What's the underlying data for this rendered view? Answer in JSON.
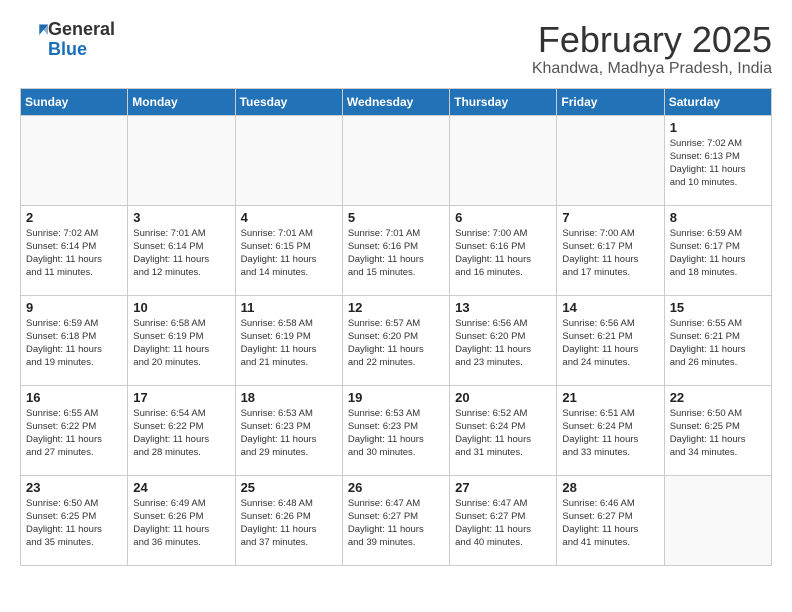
{
  "header": {
    "logo_line1": "General",
    "logo_line2": "Blue",
    "month_title": "February 2025",
    "location": "Khandwa, Madhya Pradesh, India"
  },
  "weekdays": [
    "Sunday",
    "Monday",
    "Tuesday",
    "Wednesday",
    "Thursday",
    "Friday",
    "Saturday"
  ],
  "weeks": [
    [
      {
        "day": "",
        "info": ""
      },
      {
        "day": "",
        "info": ""
      },
      {
        "day": "",
        "info": ""
      },
      {
        "day": "",
        "info": ""
      },
      {
        "day": "",
        "info": ""
      },
      {
        "day": "",
        "info": ""
      },
      {
        "day": "1",
        "info": "Sunrise: 7:02 AM\nSunset: 6:13 PM\nDaylight: 11 hours\nand 10 minutes."
      }
    ],
    [
      {
        "day": "2",
        "info": "Sunrise: 7:02 AM\nSunset: 6:14 PM\nDaylight: 11 hours\nand 11 minutes."
      },
      {
        "day": "3",
        "info": "Sunrise: 7:01 AM\nSunset: 6:14 PM\nDaylight: 11 hours\nand 12 minutes."
      },
      {
        "day": "4",
        "info": "Sunrise: 7:01 AM\nSunset: 6:15 PM\nDaylight: 11 hours\nand 14 minutes."
      },
      {
        "day": "5",
        "info": "Sunrise: 7:01 AM\nSunset: 6:16 PM\nDaylight: 11 hours\nand 15 minutes."
      },
      {
        "day": "6",
        "info": "Sunrise: 7:00 AM\nSunset: 6:16 PM\nDaylight: 11 hours\nand 16 minutes."
      },
      {
        "day": "7",
        "info": "Sunrise: 7:00 AM\nSunset: 6:17 PM\nDaylight: 11 hours\nand 17 minutes."
      },
      {
        "day": "8",
        "info": "Sunrise: 6:59 AM\nSunset: 6:17 PM\nDaylight: 11 hours\nand 18 minutes."
      }
    ],
    [
      {
        "day": "9",
        "info": "Sunrise: 6:59 AM\nSunset: 6:18 PM\nDaylight: 11 hours\nand 19 minutes."
      },
      {
        "day": "10",
        "info": "Sunrise: 6:58 AM\nSunset: 6:19 PM\nDaylight: 11 hours\nand 20 minutes."
      },
      {
        "day": "11",
        "info": "Sunrise: 6:58 AM\nSunset: 6:19 PM\nDaylight: 11 hours\nand 21 minutes."
      },
      {
        "day": "12",
        "info": "Sunrise: 6:57 AM\nSunset: 6:20 PM\nDaylight: 11 hours\nand 22 minutes."
      },
      {
        "day": "13",
        "info": "Sunrise: 6:56 AM\nSunset: 6:20 PM\nDaylight: 11 hours\nand 23 minutes."
      },
      {
        "day": "14",
        "info": "Sunrise: 6:56 AM\nSunset: 6:21 PM\nDaylight: 11 hours\nand 24 minutes."
      },
      {
        "day": "15",
        "info": "Sunrise: 6:55 AM\nSunset: 6:21 PM\nDaylight: 11 hours\nand 26 minutes."
      }
    ],
    [
      {
        "day": "16",
        "info": "Sunrise: 6:55 AM\nSunset: 6:22 PM\nDaylight: 11 hours\nand 27 minutes."
      },
      {
        "day": "17",
        "info": "Sunrise: 6:54 AM\nSunset: 6:22 PM\nDaylight: 11 hours\nand 28 minutes."
      },
      {
        "day": "18",
        "info": "Sunrise: 6:53 AM\nSunset: 6:23 PM\nDaylight: 11 hours\nand 29 minutes."
      },
      {
        "day": "19",
        "info": "Sunrise: 6:53 AM\nSunset: 6:23 PM\nDaylight: 11 hours\nand 30 minutes."
      },
      {
        "day": "20",
        "info": "Sunrise: 6:52 AM\nSunset: 6:24 PM\nDaylight: 11 hours\nand 31 minutes."
      },
      {
        "day": "21",
        "info": "Sunrise: 6:51 AM\nSunset: 6:24 PM\nDaylight: 11 hours\nand 33 minutes."
      },
      {
        "day": "22",
        "info": "Sunrise: 6:50 AM\nSunset: 6:25 PM\nDaylight: 11 hours\nand 34 minutes."
      }
    ],
    [
      {
        "day": "23",
        "info": "Sunrise: 6:50 AM\nSunset: 6:25 PM\nDaylight: 11 hours\nand 35 minutes."
      },
      {
        "day": "24",
        "info": "Sunrise: 6:49 AM\nSunset: 6:26 PM\nDaylight: 11 hours\nand 36 minutes."
      },
      {
        "day": "25",
        "info": "Sunrise: 6:48 AM\nSunset: 6:26 PM\nDaylight: 11 hours\nand 37 minutes."
      },
      {
        "day": "26",
        "info": "Sunrise: 6:47 AM\nSunset: 6:27 PM\nDaylight: 11 hours\nand 39 minutes."
      },
      {
        "day": "27",
        "info": "Sunrise: 6:47 AM\nSunset: 6:27 PM\nDaylight: 11 hours\nand 40 minutes."
      },
      {
        "day": "28",
        "info": "Sunrise: 6:46 AM\nSunset: 6:27 PM\nDaylight: 11 hours\nand 41 minutes."
      },
      {
        "day": "",
        "info": ""
      }
    ]
  ]
}
